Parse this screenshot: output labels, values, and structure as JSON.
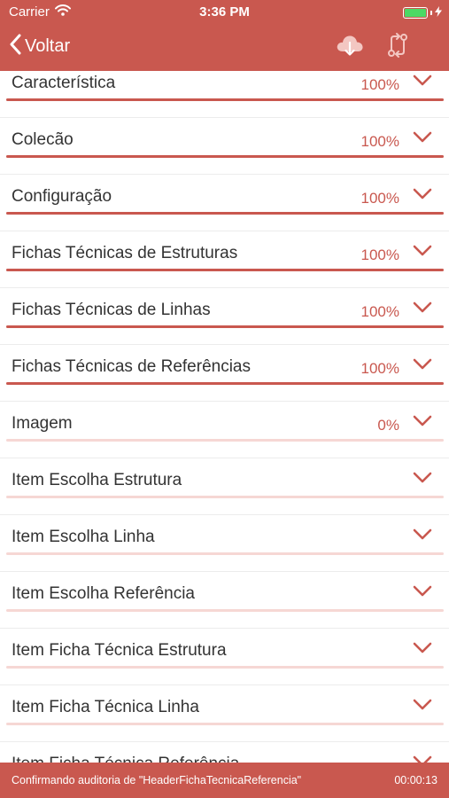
{
  "colors": {
    "accent": "#c9584f",
    "track": "#f6d7d4",
    "battery": "#4cd964"
  },
  "status_bar": {
    "carrier": "Carrier",
    "time": "3:36 PM",
    "battery_level": 1.0
  },
  "nav": {
    "back_label": "Voltar",
    "icons": [
      "cloud-download-icon",
      "sync-arrows-icon"
    ]
  },
  "list": {
    "items": [
      {
        "label": "Característica",
        "percent": "100%",
        "progress": 1.0
      },
      {
        "label": "Colecão",
        "percent": "100%",
        "progress": 1.0
      },
      {
        "label": "Configuração",
        "percent": "100%",
        "progress": 1.0
      },
      {
        "label": "Fichas Técnicas de Estruturas",
        "percent": "100%",
        "progress": 1.0
      },
      {
        "label": "Fichas Técnicas de Linhas",
        "percent": "100%",
        "progress": 1.0
      },
      {
        "label": "Fichas Técnicas de Referências",
        "percent": "100%",
        "progress": 1.0
      },
      {
        "label": "Imagem",
        "percent": "0%",
        "progress": 0.0
      },
      {
        "label": "Item Escolha Estrutura",
        "percent": "",
        "progress": 0.0
      },
      {
        "label": "Item Escolha Linha",
        "percent": "",
        "progress": 0.0
      },
      {
        "label": "Item Escolha Referência",
        "percent": "",
        "progress": 0.0
      },
      {
        "label": "Item Ficha Técnica Estrutura",
        "percent": "",
        "progress": 0.0
      },
      {
        "label": "Item Ficha Técnica Linha",
        "percent": "",
        "progress": 0.0
      },
      {
        "label": "Item Ficha Técnica Referência",
        "percent": "",
        "progress": 0.0
      }
    ]
  },
  "footer": {
    "message": "Confirmando auditoria de \"HeaderFichaTecnicaReferencia\"",
    "elapsed": "00:00:13"
  }
}
